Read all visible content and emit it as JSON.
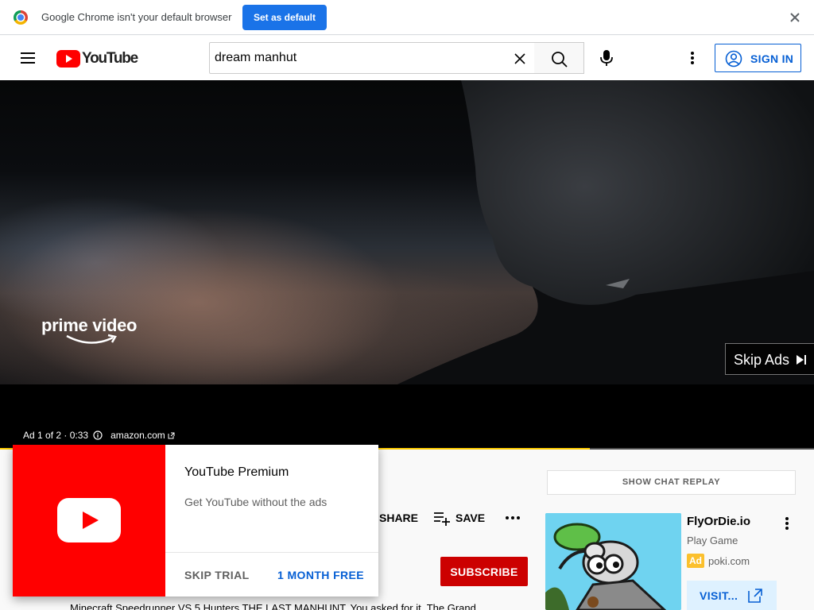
{
  "infobar": {
    "message": "Google Chrome isn't your default browser",
    "set_default_label": "Set as default",
    "close_icon": "close-icon"
  },
  "masthead": {
    "logo_text": "YouTube",
    "search": {
      "value": "dream manhut",
      "placeholder": "Search"
    },
    "signin_label": "SIGN IN",
    "icons": [
      "menu-icon",
      "clear-icon",
      "search-icon",
      "mic-icon",
      "more-vert-icon",
      "account-icon"
    ]
  },
  "player": {
    "brand_text": "prime video",
    "skip_label": "Skip Ads",
    "ad_position": "Ad 1 of 2 · 0:33",
    "ad_domain": "amazon.com",
    "ad_progress": 0.725,
    "accent_color": "#ffcc00"
  },
  "promo": {
    "title": "YouTube Premium",
    "subtitle": "Get YouTube without the ads",
    "skip_label": "SKIP TRIAL",
    "cta_label": "1 MONTH FREE"
  },
  "actions": {
    "share_label": "SHARE",
    "save_label": "SAVE",
    "subscribe_label": "SUBSCRIBE"
  },
  "description": "Minecraft Speedrunner VS 5 Hunters THE LAST MANHUNT. You asked for it. The Grand",
  "sidebar": {
    "chat_replay_label": "SHOW CHAT REPLAY",
    "ad": {
      "title": "FlyOrDie.io",
      "subtitle": "Play Game",
      "badge": "Ad",
      "domain": "poki.com",
      "visit_label": "VISIT..."
    }
  },
  "colors": {
    "brand_red": "#ff0000",
    "link_blue": "#065fd4",
    "subscribe_red": "#cc0000",
    "chrome_button_blue": "#1a73e8"
  }
}
